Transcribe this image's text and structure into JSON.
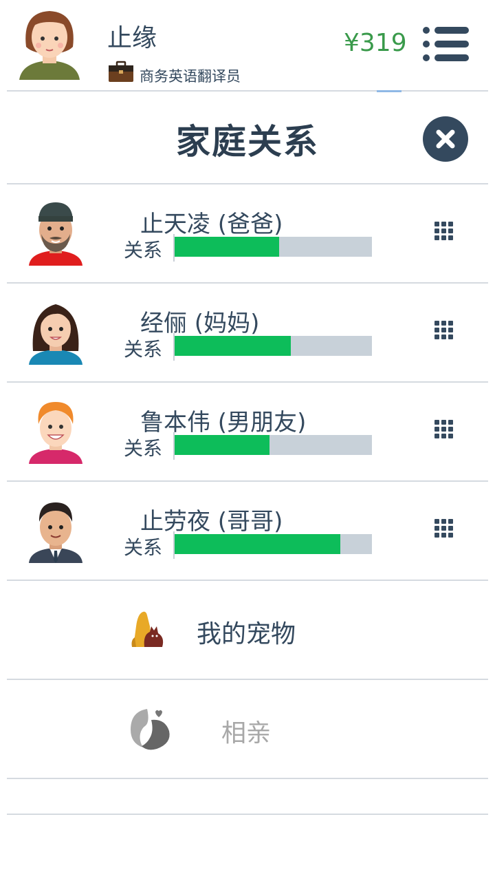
{
  "header": {
    "user_name": "止缘",
    "job_title": "商务英语翻译员",
    "money": "¥319"
  },
  "page": {
    "title": "家庭关系"
  },
  "relations": [
    {
      "name": "止天凌 (爸爸)",
      "label": "关系",
      "value": 0.53
    },
    {
      "name": "经俪 (妈妈)",
      "label": "关系",
      "value": 0.59
    },
    {
      "name": "鲁本伟 (男朋友)",
      "label": "关系",
      "value": 0.48
    },
    {
      "name": "止劳夜 (哥哥)",
      "label": "关系",
      "value": 0.84
    }
  ],
  "menu": {
    "pets_label": "我的宠物",
    "dating_label": "相亲"
  },
  "colors": {
    "money": "#3a9a4b",
    "bar_fill": "#0dbd5a",
    "bar_track": "#c8d1d9",
    "text": "#34495e",
    "close_button": "#34495e"
  },
  "icons": {
    "menu": "list-menu-icon",
    "close": "close-icon",
    "row_action": "grid-icon",
    "job": "briefcase-icon",
    "pets": "pets-icon",
    "dating": "dating-icon"
  }
}
